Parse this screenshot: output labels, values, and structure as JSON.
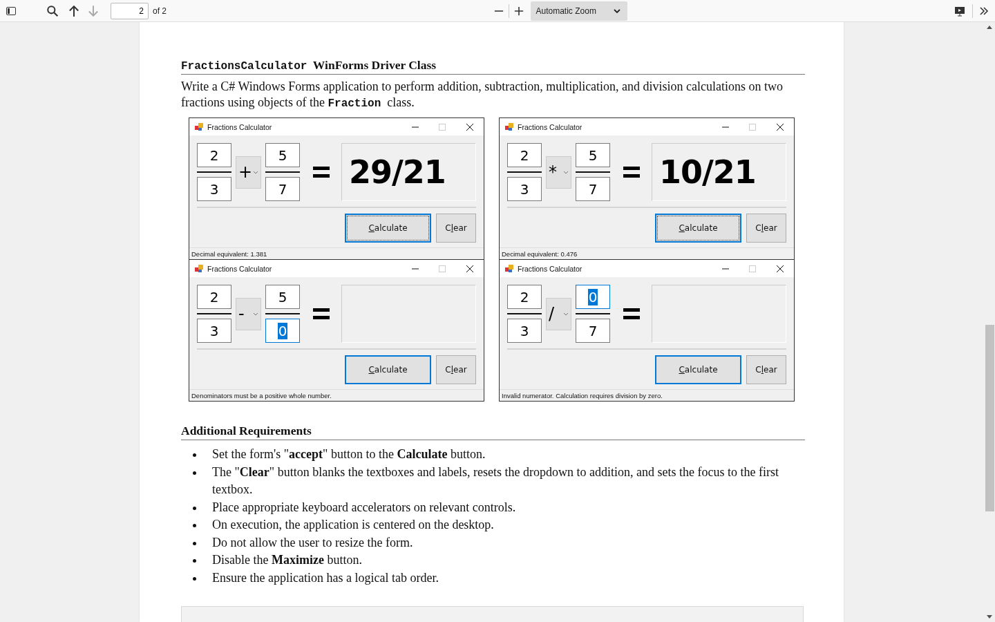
{
  "toolbar": {
    "page_number": "2",
    "page_count": "of 2",
    "zoom": "Automatic Zoom",
    "next_page_disabled": true
  },
  "section": {
    "code": "FractionsCalculator",
    "title": "WinForms Driver Class"
  },
  "intro": {
    "before": "Write a C# Windows Forms application to perform addition, subtraction, multiplication, and division calculations on two fractions using objects of the",
    "code": "Fraction",
    "after": "class."
  },
  "windows": [
    {
      "title": "Fractions Calculator",
      "num1": {
        "value": "2",
        "selected": false,
        "focused": false
      },
      "den1": {
        "value": "3",
        "selected": false,
        "focused": false
      },
      "operator": "+",
      "num2": {
        "value": "5",
        "selected": false,
        "focused": false
      },
      "den2": {
        "value": "7",
        "selected": false,
        "focused": false
      },
      "result": "29/21",
      "calculate": {
        "accel_letter": "C",
        "after": "alculate",
        "focused": true
      },
      "clear": {
        "before": "C",
        "accel_letter": "l",
        "after": "ear"
      },
      "status": "Decimal equivalent: 1.381"
    },
    {
      "title": "Fractions Calculator",
      "num1": {
        "value": "2",
        "selected": false,
        "focused": false
      },
      "den1": {
        "value": "3",
        "selected": false,
        "focused": false
      },
      "operator": "*",
      "num2": {
        "value": "5",
        "selected": false,
        "focused": false
      },
      "den2": {
        "value": "7",
        "selected": false,
        "focused": false
      },
      "result": "10/21",
      "calculate": {
        "accel_letter": "C",
        "after": "alculate",
        "focused": true
      },
      "clear": {
        "before": "C",
        "accel_letter": "l",
        "after": "ear"
      },
      "status": "Decimal equivalent: 0.476"
    },
    {
      "title": "Fractions Calculator",
      "num1": {
        "value": "2",
        "selected": false,
        "focused": false
      },
      "den1": {
        "value": "3",
        "selected": false,
        "focused": false
      },
      "operator": "-",
      "num2": {
        "value": "5",
        "selected": false,
        "focused": false
      },
      "den2": {
        "value": "0",
        "selected": true,
        "focused": true
      },
      "calculate": {
        "accel_letter": "C",
        "after": "alculate",
        "focused": false
      },
      "clear": {
        "before": "C",
        "accel_letter": "l",
        "after": "ear"
      },
      "status": "Denominators must be a positive whole number."
    },
    {
      "title": "Fractions Calculator",
      "num1": {
        "value": "2",
        "selected": false,
        "focused": false
      },
      "den1": {
        "value": "3",
        "selected": false,
        "focused": false
      },
      "operator": "/",
      "num2": {
        "value": "0",
        "selected": true,
        "focused": true
      },
      "den2": {
        "value": "7",
        "selected": false,
        "focused": false
      },
      "calculate": {
        "accel_letter": "C",
        "after": "alculate",
        "focused": false
      },
      "clear": {
        "before": "C",
        "accel_letter": "l",
        "after": "ear"
      },
      "status": "Invalid numerator. Calculation requires division by zero."
    }
  ],
  "requirements_heading": "Additional Requirements",
  "requirements": [
    "Set the form's \"**accept**\" button to the **Calculate** button.",
    "The \"**Clear**\" button blanks the textboxes and labels, resets the dropdown to addition, and sets the focus to the first textbox.",
    "Place appropriate keyboard accelerators on relevant controls.",
    "On execution, the application is centered on the desktop.",
    "Do not allow the user to resize the form.",
    "Disable the **Maximize** button.",
    "Ensure the application has a logical tab order."
  ]
}
